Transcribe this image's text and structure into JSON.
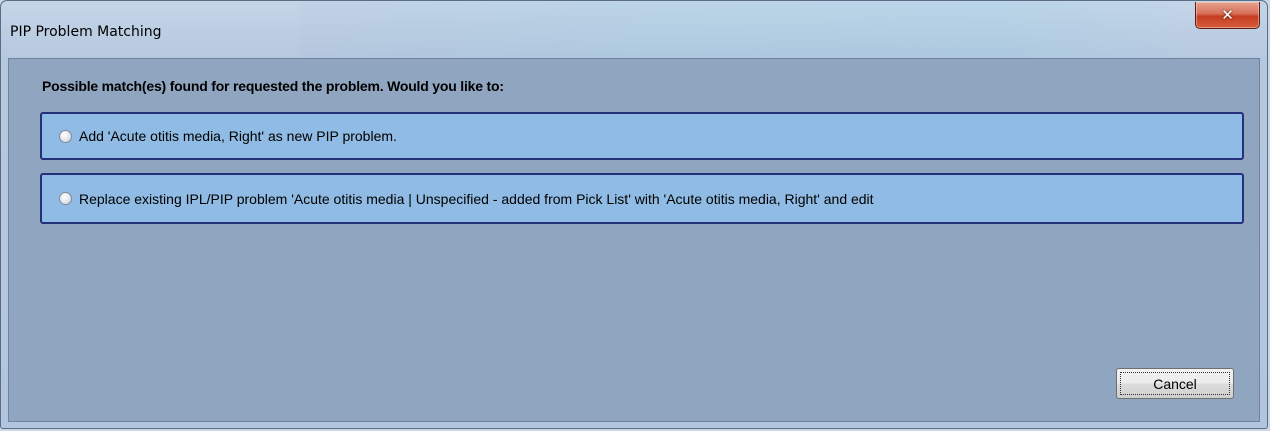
{
  "window": {
    "title": "PIP Problem Matching",
    "close_icon": "close-icon"
  },
  "dialog": {
    "prompt": "Possible match(es) found for requested the problem.  Would you like to:",
    "options": [
      {
        "label": "Add 'Acute otitis media, Right' as new PIP problem.",
        "selected": false
      },
      {
        "label": "Replace existing IPL/PIP problem 'Acute otitis media | Unspecified - added from Pick List' with 'Acute otitis media, Right' and edit",
        "selected": false
      }
    ],
    "cancel_label": "Cancel"
  }
}
